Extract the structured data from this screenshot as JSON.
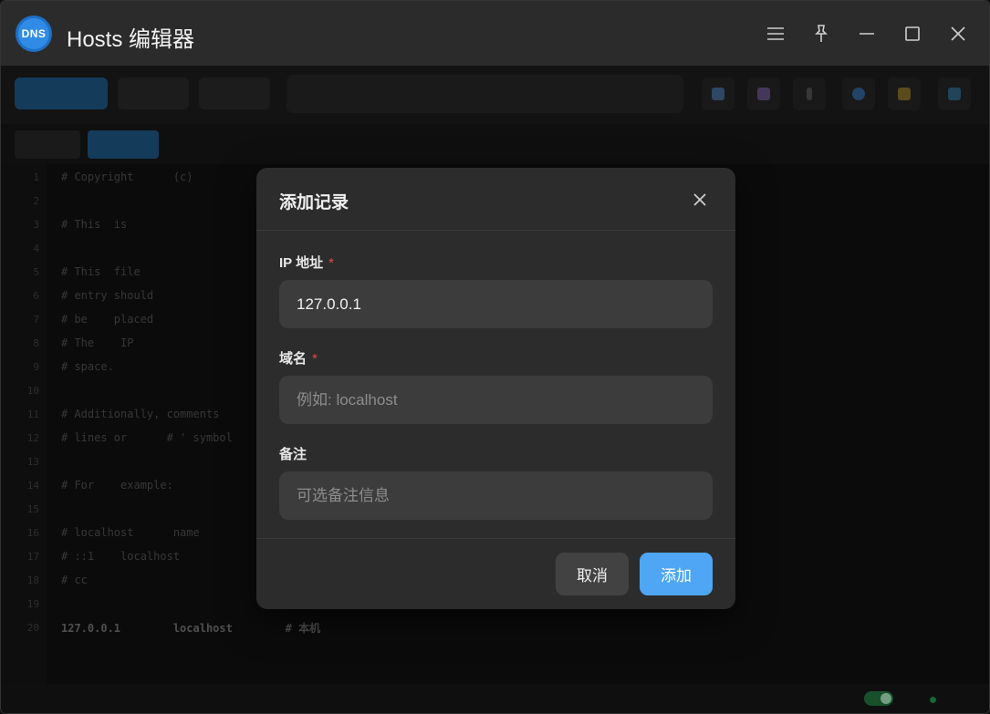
{
  "window": {
    "logo_text": "DNS",
    "title": "Hosts 编辑器"
  },
  "dialog": {
    "title": "添加记录",
    "ip_field": {
      "label": "IP 地址",
      "required_mark": "*",
      "value": "127.0.0.1",
      "placeholder": ""
    },
    "domain_field": {
      "label": "域名",
      "required_mark": "*",
      "value": "",
      "placeholder": "例如: localhost"
    },
    "note_field": {
      "label": "备注",
      "value": "",
      "placeholder": "可选备注信息"
    },
    "cancel_label": "取消",
    "add_label": "添加"
  },
  "colors": {
    "accent": "#4ea6f5",
    "required": "#e04a4a",
    "dialog_bg": "#2c2c2c",
    "field_bg": "#3c3c3c"
  },
  "background_editor": {
    "lines": [
      {
        "n": "1",
        "t": "# Copyright      (c)"
      },
      {
        "n": "2",
        "t": ""
      },
      {
        "n": "3",
        "t": "# This  is"
      },
      {
        "n": "4",
        "t": ""
      },
      {
        "n": "5",
        "t": "# This  file"
      },
      {
        "n": "6",
        "t": "# entry should"
      },
      {
        "n": "7",
        "t": "# be    placed"
      },
      {
        "n": "8",
        "t": "# The    IP"
      },
      {
        "n": "9",
        "t": "# space."
      },
      {
        "n": "10",
        "t": ""
      },
      {
        "n": "11",
        "t": "# Additionally, comments"
      },
      {
        "n": "12",
        "t": "# lines or      # ' symbol"
      },
      {
        "n": "13",
        "t": ""
      },
      {
        "n": "14",
        "t": "# For    example:"
      },
      {
        "n": "15",
        "t": ""
      },
      {
        "n": "16",
        "t": "# localhost      name"
      },
      {
        "n": "17",
        "t": "# ::1    localhost"
      },
      {
        "n": "18",
        "t": "# cc"
      },
      {
        "n": "19",
        "t": ""
      },
      {
        "n": "20",
        "t": "127.0.0.1        localhost        # 本机"
      }
    ]
  }
}
